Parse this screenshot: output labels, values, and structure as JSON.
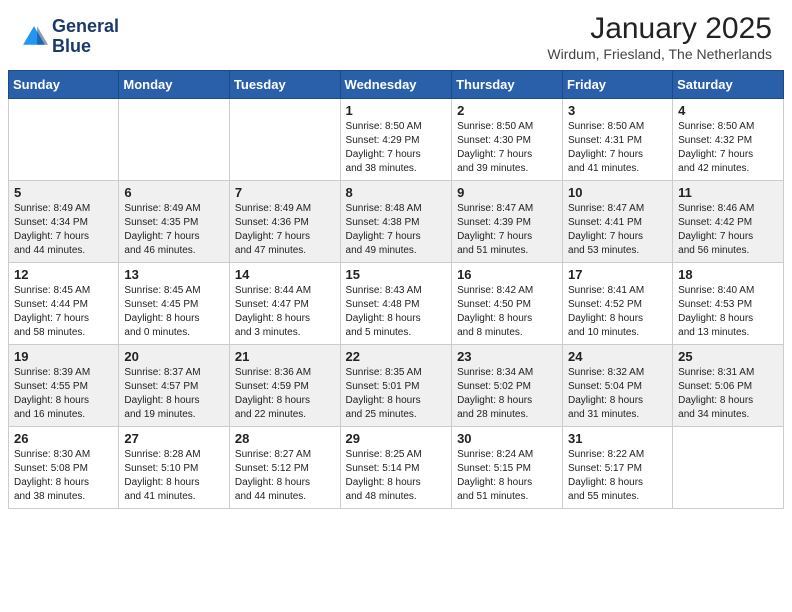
{
  "header": {
    "logo_line1": "General",
    "logo_line2": "Blue",
    "month": "January 2025",
    "location": "Wirdum, Friesland, The Netherlands"
  },
  "weekdays": [
    "Sunday",
    "Monday",
    "Tuesday",
    "Wednesday",
    "Thursday",
    "Friday",
    "Saturday"
  ],
  "weeks": [
    [
      {
        "day": "",
        "info": ""
      },
      {
        "day": "",
        "info": ""
      },
      {
        "day": "",
        "info": ""
      },
      {
        "day": "1",
        "info": "Sunrise: 8:50 AM\nSunset: 4:29 PM\nDaylight: 7 hours\nand 38 minutes."
      },
      {
        "day": "2",
        "info": "Sunrise: 8:50 AM\nSunset: 4:30 PM\nDaylight: 7 hours\nand 39 minutes."
      },
      {
        "day": "3",
        "info": "Sunrise: 8:50 AM\nSunset: 4:31 PM\nDaylight: 7 hours\nand 41 minutes."
      },
      {
        "day": "4",
        "info": "Sunrise: 8:50 AM\nSunset: 4:32 PM\nDaylight: 7 hours\nand 42 minutes."
      }
    ],
    [
      {
        "day": "5",
        "info": "Sunrise: 8:49 AM\nSunset: 4:34 PM\nDaylight: 7 hours\nand 44 minutes."
      },
      {
        "day": "6",
        "info": "Sunrise: 8:49 AM\nSunset: 4:35 PM\nDaylight: 7 hours\nand 46 minutes."
      },
      {
        "day": "7",
        "info": "Sunrise: 8:49 AM\nSunset: 4:36 PM\nDaylight: 7 hours\nand 47 minutes."
      },
      {
        "day": "8",
        "info": "Sunrise: 8:48 AM\nSunset: 4:38 PM\nDaylight: 7 hours\nand 49 minutes."
      },
      {
        "day": "9",
        "info": "Sunrise: 8:47 AM\nSunset: 4:39 PM\nDaylight: 7 hours\nand 51 minutes."
      },
      {
        "day": "10",
        "info": "Sunrise: 8:47 AM\nSunset: 4:41 PM\nDaylight: 7 hours\nand 53 minutes."
      },
      {
        "day": "11",
        "info": "Sunrise: 8:46 AM\nSunset: 4:42 PM\nDaylight: 7 hours\nand 56 minutes."
      }
    ],
    [
      {
        "day": "12",
        "info": "Sunrise: 8:45 AM\nSunset: 4:44 PM\nDaylight: 7 hours\nand 58 minutes."
      },
      {
        "day": "13",
        "info": "Sunrise: 8:45 AM\nSunset: 4:45 PM\nDaylight: 8 hours\nand 0 minutes."
      },
      {
        "day": "14",
        "info": "Sunrise: 8:44 AM\nSunset: 4:47 PM\nDaylight: 8 hours\nand 3 minutes."
      },
      {
        "day": "15",
        "info": "Sunrise: 8:43 AM\nSunset: 4:48 PM\nDaylight: 8 hours\nand 5 minutes."
      },
      {
        "day": "16",
        "info": "Sunrise: 8:42 AM\nSunset: 4:50 PM\nDaylight: 8 hours\nand 8 minutes."
      },
      {
        "day": "17",
        "info": "Sunrise: 8:41 AM\nSunset: 4:52 PM\nDaylight: 8 hours\nand 10 minutes."
      },
      {
        "day": "18",
        "info": "Sunrise: 8:40 AM\nSunset: 4:53 PM\nDaylight: 8 hours\nand 13 minutes."
      }
    ],
    [
      {
        "day": "19",
        "info": "Sunrise: 8:39 AM\nSunset: 4:55 PM\nDaylight: 8 hours\nand 16 minutes."
      },
      {
        "day": "20",
        "info": "Sunrise: 8:37 AM\nSunset: 4:57 PM\nDaylight: 8 hours\nand 19 minutes."
      },
      {
        "day": "21",
        "info": "Sunrise: 8:36 AM\nSunset: 4:59 PM\nDaylight: 8 hours\nand 22 minutes."
      },
      {
        "day": "22",
        "info": "Sunrise: 8:35 AM\nSunset: 5:01 PM\nDaylight: 8 hours\nand 25 minutes."
      },
      {
        "day": "23",
        "info": "Sunrise: 8:34 AM\nSunset: 5:02 PM\nDaylight: 8 hours\nand 28 minutes."
      },
      {
        "day": "24",
        "info": "Sunrise: 8:32 AM\nSunset: 5:04 PM\nDaylight: 8 hours\nand 31 minutes."
      },
      {
        "day": "25",
        "info": "Sunrise: 8:31 AM\nSunset: 5:06 PM\nDaylight: 8 hours\nand 34 minutes."
      }
    ],
    [
      {
        "day": "26",
        "info": "Sunrise: 8:30 AM\nSunset: 5:08 PM\nDaylight: 8 hours\nand 38 minutes."
      },
      {
        "day": "27",
        "info": "Sunrise: 8:28 AM\nSunset: 5:10 PM\nDaylight: 8 hours\nand 41 minutes."
      },
      {
        "day": "28",
        "info": "Sunrise: 8:27 AM\nSunset: 5:12 PM\nDaylight: 8 hours\nand 44 minutes."
      },
      {
        "day": "29",
        "info": "Sunrise: 8:25 AM\nSunset: 5:14 PM\nDaylight: 8 hours\nand 48 minutes."
      },
      {
        "day": "30",
        "info": "Sunrise: 8:24 AM\nSunset: 5:15 PM\nDaylight: 8 hours\nand 51 minutes."
      },
      {
        "day": "31",
        "info": "Sunrise: 8:22 AM\nSunset: 5:17 PM\nDaylight: 8 hours\nand 55 minutes."
      },
      {
        "day": "",
        "info": ""
      }
    ]
  ]
}
